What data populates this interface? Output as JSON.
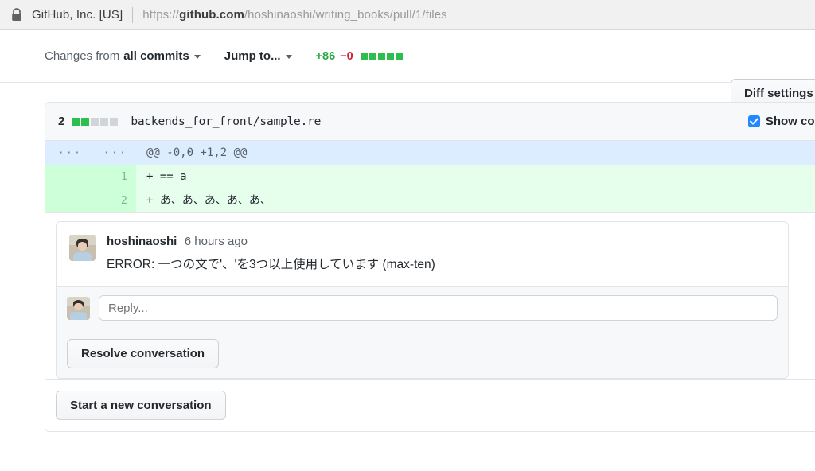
{
  "browser": {
    "lock_icon": "lock-icon",
    "site_name": "GitHub, Inc. [US]",
    "url_scheme": "https://",
    "url_host": "github.com",
    "url_path": "/hoshinaoshi/writing_books/pull/1/files"
  },
  "toolbar": {
    "changes_from_label": "Changes from",
    "changes_from_value": "all commits",
    "jump_to_label": "Jump to...",
    "additions": "+86",
    "deletions": "−0",
    "diff_blocks": [
      "green",
      "green",
      "green",
      "green",
      "green"
    ],
    "diff_settings_label": "Diff settings"
  },
  "file": {
    "changed_count": "2",
    "stat_blocks": [
      "green",
      "green",
      "gray",
      "gray",
      "gray"
    ],
    "path": "backends_for_front/sample.re",
    "show_comments_label": "Show comments",
    "show_comments_checked": true
  },
  "diff": {
    "rows": [
      {
        "type": "hunk",
        "old_gutter": "···",
        "new_gutter": "···",
        "code": "@@ -0,0 +1,2 @@"
      },
      {
        "type": "add",
        "old_gutter": "",
        "new_gutter": "1",
        "code": "+ == a"
      },
      {
        "type": "add",
        "old_gutter": "",
        "new_gutter": "2",
        "code": "+ あ、あ、あ、あ、あ、"
      }
    ]
  },
  "thread": {
    "author": "hoshinaoshi",
    "timestamp": "6 hours ago",
    "comment_text": "ERROR: 一つの文で'、'を3つ以上使用しています (max-ten)",
    "reply_placeholder": "Reply...",
    "resolve_label": "Resolve conversation"
  },
  "footer": {
    "start_conversation_label": "Start a new conversation"
  },
  "colors": {
    "add_green": "#28a745",
    "del_red": "#cb2431",
    "block_green": "#2cbe4e",
    "block_gray": "#d1d5da",
    "checkbox_blue": "#2188ff",
    "diff_add_bg": "#e6ffed",
    "diff_add_gutter_bg": "#cdffd8",
    "hunk_bg": "#dbedff"
  }
}
